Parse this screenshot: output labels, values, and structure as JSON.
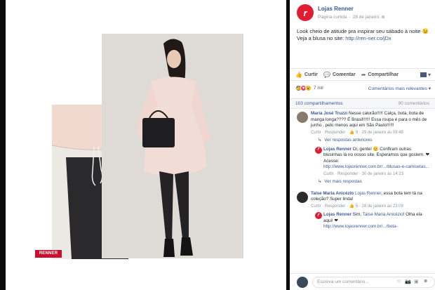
{
  "post": {
    "page_name": "Lojas Renner",
    "page_type": "Página curtida",
    "date": "28 de janeiro",
    "caption": "Look cheio de atitude pra inspirar seu sábado à noite 😉 Veja a blusa no site: ",
    "caption_link": "http://ren-ner.co/jDx"
  },
  "photo": {
    "brand_label": "RENNER"
  },
  "actions": {
    "like": "Curtir",
    "comment": "Comentar",
    "share": "Compartilhar"
  },
  "reactions": {
    "count": "7 mil",
    "filter_label": "Comentários mais relevantes ▾"
  },
  "counts": {
    "shares": "103 compartilhamentos",
    "comments": "90 comentários"
  },
  "comments": [
    {
      "author": "Maria José Truzzi",
      "text": "Nesse calorão!!!!! Calça, bota, bota de manga longa???? É Brasil!!!!!! Essa roupa é para o mês de junho , pelo menos aqui em São Paulo!!!!!!",
      "actions": "Curtir · Responder · 👍 9 · 29 de janeiro às 09:48",
      "previous_replies": "Ver respostas anteriores",
      "reply": {
        "author": "Lojas Renner",
        "text": "Oi, gente! 😊 Confiram outras blusinhas lá no nosso site. Esperamos que gostem. ❤ Acesse:",
        "link": "http://www.lojasrenner.com.br/.../blusas-e-camisetas...",
        "actions": "Curtir · Responder · 30 de janeiro às 14:23"
      },
      "more_replies": "Ver mais respostas"
    },
    {
      "author": "Taíse Maria Anicézio",
      "mention": "Lojas Renner",
      "text": ", essa bota tem tá na coleção? Super linda!",
      "actions": "Curtir · Responder · 👍 5 · 28 de janeiro às 23:09",
      "reply": {
        "author": "Lojas Renner",
        "mention": "Taíse Maria Anicézio",
        "text_prefix": "Sim, ",
        "text_suffix": "! Olha ela aqui! ❤",
        "link": "http://www.lojasrenner.com.br/.../bota-"
      }
    }
  ],
  "composer": {
    "placeholder": "Escreva um comentário..."
  },
  "colors": {
    "brand": "#c8102e",
    "link": "#365899",
    "muted": "#90949c"
  }
}
